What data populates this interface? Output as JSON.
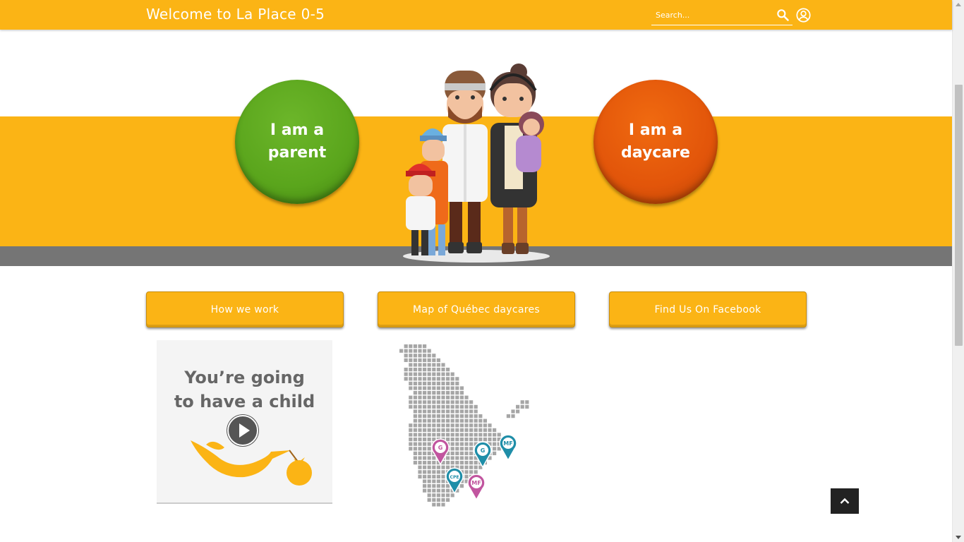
{
  "header": {
    "title": "Welcome to La Place 0-5",
    "search_placeholder": "Search...",
    "search_icon": "search-icon",
    "user_icon": "user-account-icon"
  },
  "hero": {
    "parent_button": "I am a\nparent",
    "daycare_button": "I am a\ndaycare",
    "illustration": "family-illustration",
    "colors": {
      "band": "#fbb415",
      "strip": "#757575",
      "parent": "#5aa51c",
      "daycare": "#e2550a"
    }
  },
  "links": {
    "how_we_work": "How we work",
    "map": "Map of Québec daycares",
    "facebook": "Find Us On Facebook"
  },
  "video": {
    "title": "You’re going\nto have a child",
    "play_icon": "play-icon"
  },
  "map": {
    "pins": [
      "G",
      "G",
      "MF",
      "CPE",
      "MF"
    ]
  },
  "back_to_top_icon": "chevron-up-icon"
}
